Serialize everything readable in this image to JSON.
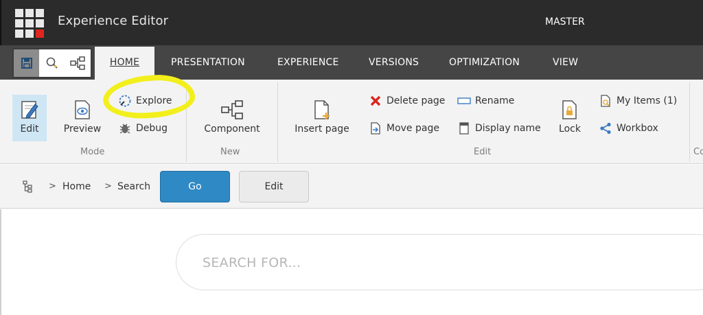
{
  "header": {
    "app_title": "Experience Editor",
    "database": "MASTER"
  },
  "quick_access": {
    "save_icon": "save-icon",
    "search_icon": "search-icon",
    "navigate_icon": "hierarchy-icon"
  },
  "tabs": [
    {
      "label": "HOME",
      "active": true
    },
    {
      "label": "PRESENTATION"
    },
    {
      "label": "EXPERIENCE"
    },
    {
      "label": "VERSIONS"
    },
    {
      "label": "OPTIMIZATION"
    },
    {
      "label": "VIEW"
    }
  ],
  "ribbon": {
    "mode": {
      "group_label": "Mode",
      "edit": "Edit",
      "preview": "Preview",
      "explore": "Explore",
      "debug": "Debug"
    },
    "new": {
      "group_label": "New",
      "component": "Component"
    },
    "edit": {
      "group_label": "Edit",
      "insert_page": "Insert page",
      "delete_page": "Delete page",
      "move_page": "Move page",
      "rename": "Rename",
      "display_name": "Display name",
      "lock": "Lock",
      "my_items": "My Items (1)",
      "workbox": "Workbox"
    },
    "next_group_partial": "Co"
  },
  "breadcrumb": {
    "items": [
      "Home",
      "Search"
    ],
    "go_label": "Go",
    "edit_label": "Edit"
  },
  "search": {
    "placeholder": "SEARCH FOR...",
    "value": ""
  },
  "colors": {
    "accent_blue": "#2f89c4",
    "highlight_yellow": "#f2ef1c",
    "delete_red": "#d9261c",
    "logo_red": "#e0261e"
  }
}
